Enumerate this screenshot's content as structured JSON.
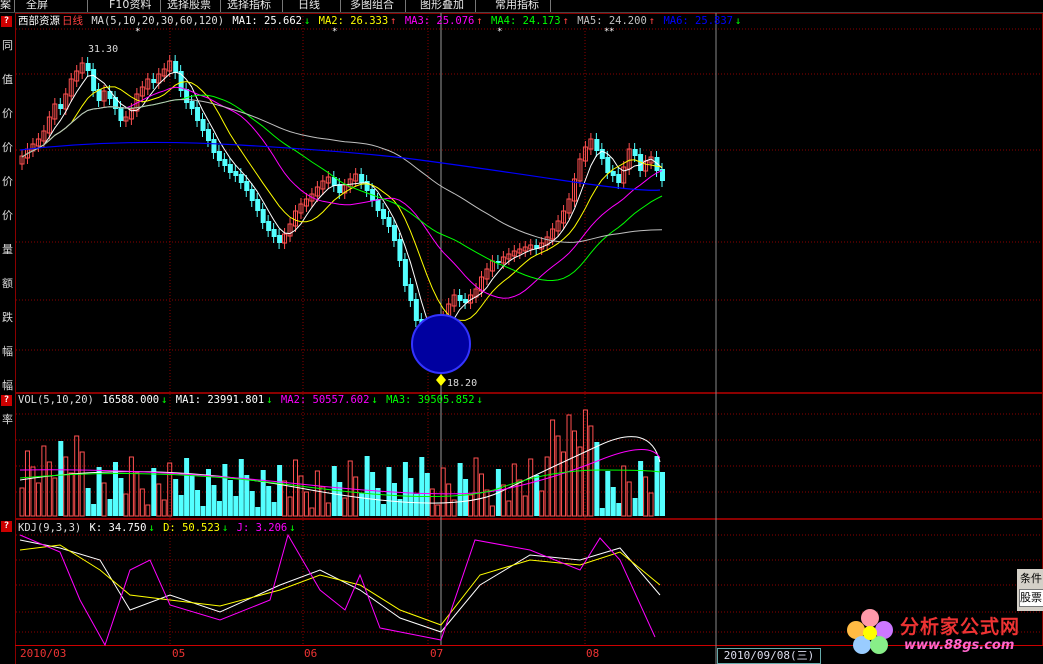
{
  "toolbar": {
    "items": [
      "案",
      "全屏",
      "F10资料",
      "选择股票",
      "选择指标",
      "日线",
      "多图组合",
      "图形叠加",
      "常用指标"
    ]
  },
  "left_strip": {
    "chars": [
      "同",
      "值",
      "价",
      "价",
      "价",
      "价",
      "量",
      "额",
      "跌",
      "幅",
      "幅",
      "率"
    ]
  },
  "price_panel": {
    "stock_name": "西部资源",
    "period": "日线",
    "indicator": "MA(5,10,20,30,60,120)",
    "ma": [
      {
        "label": "MA1: 25.662",
        "arrow": "↓",
        "color": "#ffffff"
      },
      {
        "label": "MA2: 26.333",
        "arrow": "↑",
        "color": "#ffff00"
      },
      {
        "label": "MA3: 25.076",
        "arrow": "↑",
        "color": "#ff00ff"
      },
      {
        "label": "MA4: 24.173",
        "arrow": "↑",
        "color": "#00ff00"
      },
      {
        "label": "MA5: 24.200",
        "arrow": "↑",
        "color": "#c0c0c0"
      },
      {
        "label": "MA6: 25.837",
        "arrow": "↓",
        "color": "#0000ff"
      }
    ],
    "high_label": "31.30",
    "low_label": "18.20"
  },
  "vol_panel": {
    "indicator": "VOL(5,10,20)",
    "value": "16588.000",
    "ma": [
      {
        "label": "MA1: 23991.801",
        "arrow": "↓",
        "color": "#ffffff"
      },
      {
        "label": "MA2: 50557.602",
        "arrow": "↓",
        "color": "#ff00ff"
      },
      {
        "label": "MA3: 39505.852",
        "arrow": "↓",
        "color": "#00ff00"
      }
    ]
  },
  "kdj_panel": {
    "indicator": "KDJ(9,3,3)",
    "k": "K: 34.750",
    "k_arrow": "↓",
    "d": "D: 50.523",
    "d_arrow": "↓",
    "j": "J: 3.206",
    "j_arrow": "↓"
  },
  "x_axis": {
    "labels": [
      "2010/03",
      "05",
      "06",
      "07",
      "08"
    ]
  },
  "date_box": "2010/09/08(三)",
  "condition_panel": {
    "title": "条件",
    "button": "股票"
  },
  "watermark": {
    "text": "分析家公式网",
    "url": "www.88gs.com"
  },
  "colors": {
    "up": "#ff5050",
    "down": "#54ffff",
    "grid": "#8b0000",
    "bg": "#000000"
  }
}
